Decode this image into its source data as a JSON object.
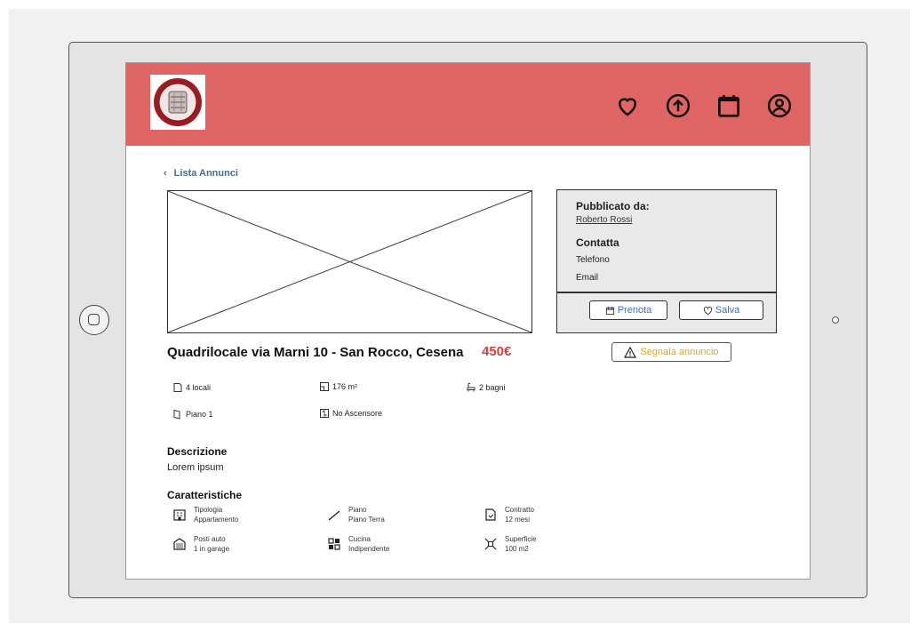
{
  "header": {
    "logo_alt": "University seal",
    "icons": [
      "heart-icon",
      "upload-icon",
      "calendar-icon",
      "user-icon"
    ]
  },
  "nav": {
    "back_label": "Lista Annunci"
  },
  "listing": {
    "title": "Quadrilocale via Marni 10 - San Rocco, Cesena",
    "price": "450€"
  },
  "publisher": {
    "title": "Pubblicato da:",
    "name": "Roberto Rossi",
    "contact_title": "Contatta",
    "phone_label": "Telefono",
    "email_label": "Email"
  },
  "actions": {
    "prenota": "Prenota",
    "salva": "Salva",
    "segnala": "Segnala annuncio"
  },
  "features": {
    "locali": "4 locali",
    "area": "176 m²",
    "bagni": "2 bagni",
    "piano": "Piano 1",
    "ascensore": "No Ascensore"
  },
  "description": {
    "title": "Descrizione",
    "text": "Lorem ipsum"
  },
  "characteristics": {
    "title": "Caratteristiche",
    "items": [
      {
        "label": "Tipologia",
        "value": "Appartamento",
        "icon": "building-icon"
      },
      {
        "label": "Piano",
        "value": "Piano Terra",
        "icon": "stairs-icon"
      },
      {
        "label": "Contratto",
        "value": "12 mesi",
        "icon": "contract-icon"
      },
      {
        "label": "Posti auto",
        "value": "1 in garage",
        "icon": "garage-icon"
      },
      {
        "label": "Cucina",
        "value": "Indipendente",
        "icon": "kitchen-icon"
      },
      {
        "label": "Superficie",
        "value": "100 m2",
        "icon": "area-icon"
      }
    ]
  },
  "colors": {
    "header_bg": "#de6563",
    "price": "#e03a3a",
    "link": "#3f6e93",
    "button_text": "#3b6fd6",
    "warning": "#e8a21f"
  }
}
